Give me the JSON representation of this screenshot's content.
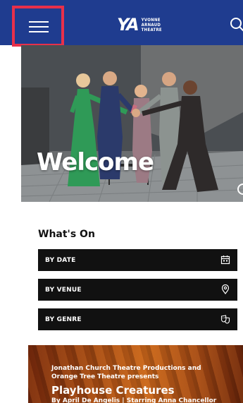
{
  "header": {
    "logo_mark": "YA",
    "logo_line1": "YVONNE",
    "logo_line2": "ARNAUD",
    "logo_line3": "THEATRE",
    "menu_icon": "hamburger-menu-icon",
    "search_icon": "search-icon",
    "highlight_color": "#e8304a",
    "brand_color": "#1f3c8f"
  },
  "hero": {
    "heading": "Welcome"
  },
  "whats_on": {
    "title": "What's On",
    "filters": [
      {
        "label": "BY DATE",
        "icon": "calendar-icon"
      },
      {
        "label": "BY VENUE",
        "icon": "location-pin-icon"
      },
      {
        "label": "BY GENRE",
        "icon": "theatre-masks-icon"
      }
    ]
  },
  "promo": {
    "presenter": "Jonathan Church Theatre Productions and Orange Tree Theatre presents",
    "title": "Playhouse Creatures",
    "credit": "By April De Angelis | Starring Anna Chancellor"
  }
}
